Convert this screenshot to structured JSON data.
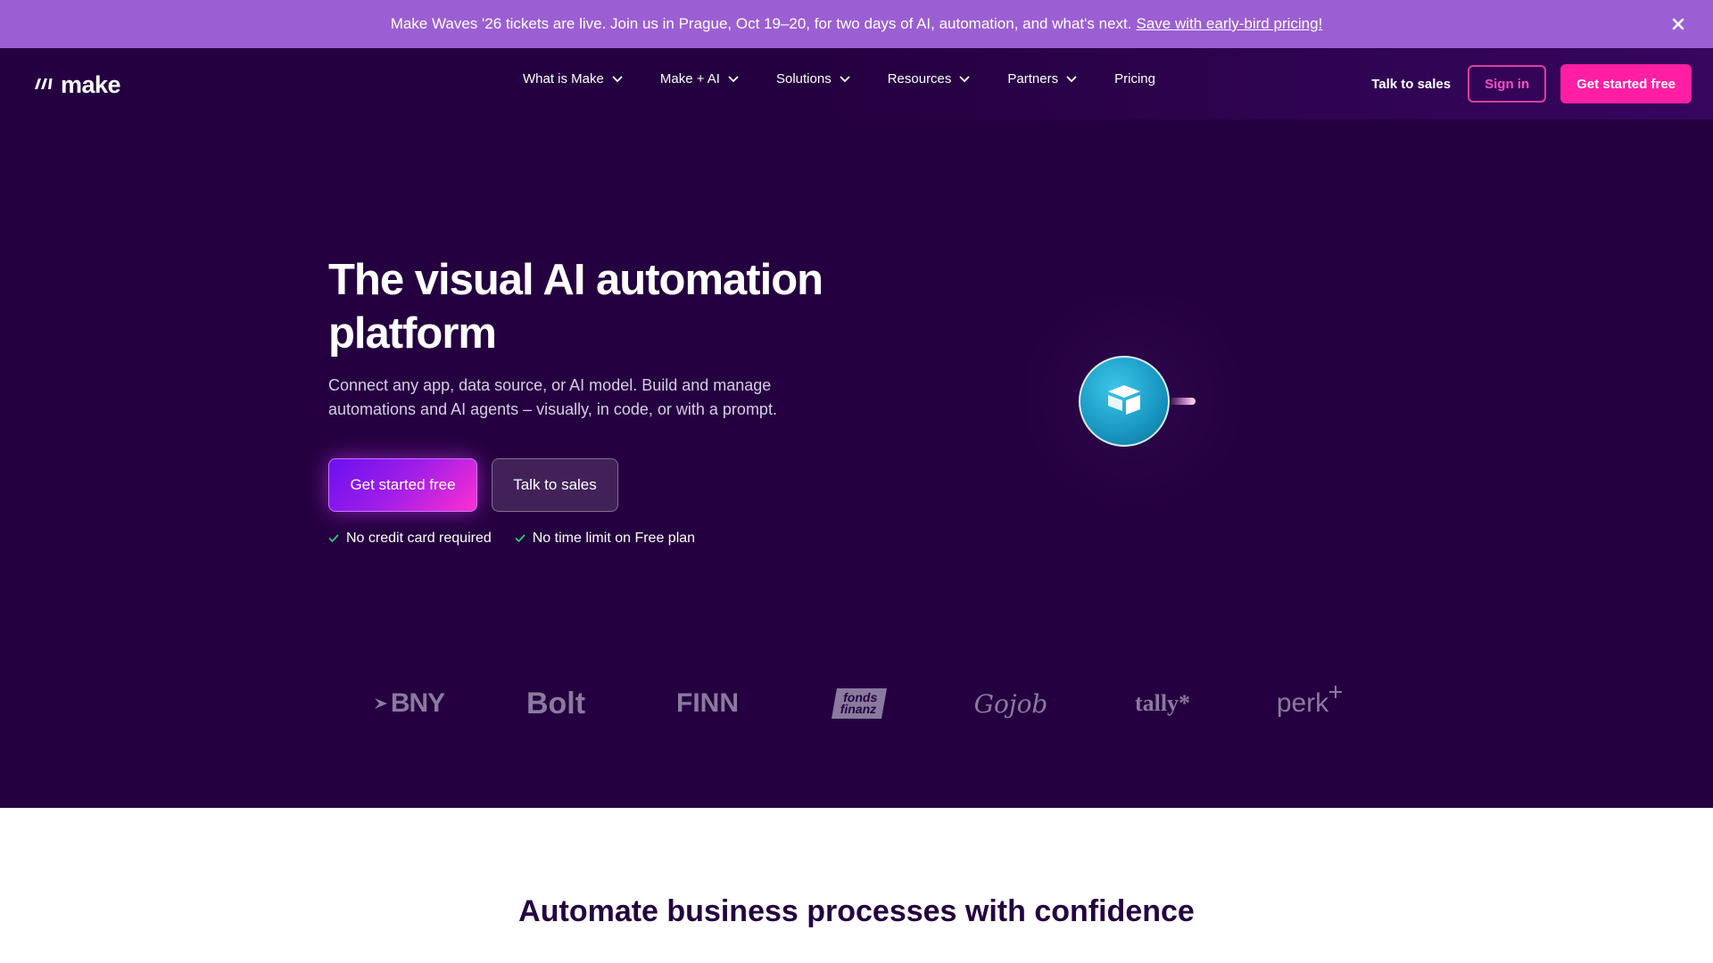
{
  "banner": {
    "text": "Make Waves '26 tickets are live. Join us in Prague, Oct 19–20, for two days of AI, automation, and what's next.",
    "link": "Save with early-bird pricing!",
    "close_icon": "close-icon"
  },
  "nav": {
    "logo_text": "make",
    "menu": [
      {
        "label": "What is Make",
        "has_dropdown": true
      },
      {
        "label": "Make + AI",
        "has_dropdown": true
      },
      {
        "label": "Solutions",
        "has_dropdown": true
      },
      {
        "label": "Resources",
        "has_dropdown": true
      },
      {
        "label": "Partners",
        "has_dropdown": true
      },
      {
        "label": "Pricing",
        "has_dropdown": false
      }
    ],
    "talk_to_sales": "Talk to sales",
    "sign_in": "Sign in",
    "get_started": "Get started free"
  },
  "hero": {
    "headline": "The visual AI automation platform",
    "subtext": "Connect any app, data source, or AI model. Build and manage automations and AI agents – visually, in code, or with a prompt.",
    "cta_primary": "Get started free",
    "cta_secondary": "Talk to sales",
    "checks": [
      "No credit card required",
      "No time limit on Free plan"
    ]
  },
  "logos": {
    "bny": "BNY",
    "bolt": "Bolt",
    "finn": "FINN",
    "fonds_line1": "fonds",
    "fonds_line2": "finanz",
    "gojob": "Gojob",
    "tally": "tally*",
    "perk": "perk"
  },
  "section": {
    "title": "Automate business processes with confidence"
  },
  "colors": {
    "banner_bg": "#9b5fd3",
    "hero_bg": "#250040",
    "accent_pink": "#ff1ea4",
    "check_green": "#2ecc71"
  }
}
